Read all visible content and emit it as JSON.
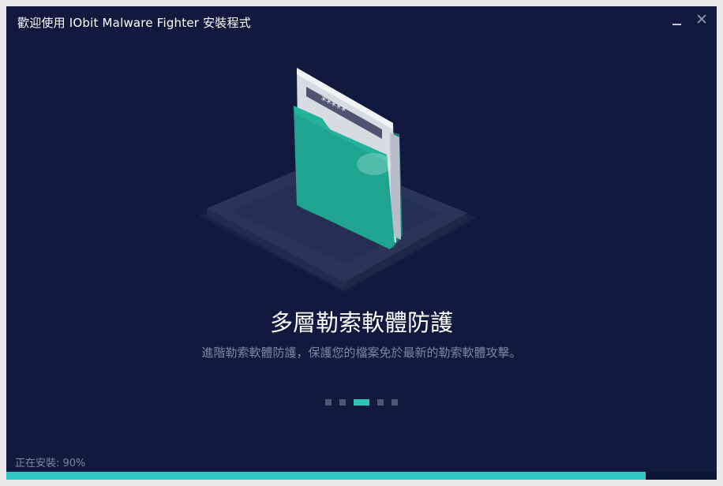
{
  "window": {
    "title": "歡迎使用 IObit Malware Fighter 安裝程式",
    "close_glyph": "✕"
  },
  "illustration": {
    "icon": "folder-lock-icon",
    "password_mask": "*****"
  },
  "slide": {
    "heading": "多層勒索軟體防護",
    "description": "進階勒索軟體防護，保護您的檔案免於最新的勒索軟體攻擊。"
  },
  "carousel": {
    "count": 5,
    "active_index": 2
  },
  "install": {
    "status_text": "正在安裝: 90%",
    "progress_fraction": 0.9
  },
  "colors": {
    "background": "#111a3e",
    "accent": "#2ec9c5",
    "folder": "#1fa58f",
    "text_muted": "#7e86a3"
  }
}
